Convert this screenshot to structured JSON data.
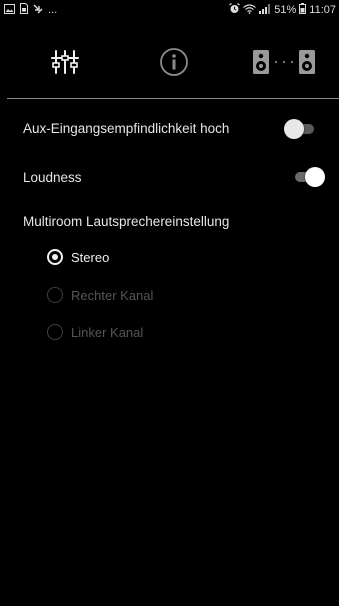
{
  "status_bar": {
    "left_icons": [
      "gallery-icon",
      "sim-icon",
      "missed-call-icon"
    ],
    "ellipsis": "...",
    "battery": "51%",
    "time": "11:07"
  },
  "toolbar": {
    "tabs": [
      {
        "name": "equalizer-settings-tab",
        "icon": "sliders-icon"
      },
      {
        "name": "info-tab",
        "icon": "info-icon"
      },
      {
        "name": "speaker-pairing-tab",
        "icon": "speakers-icon"
      }
    ]
  },
  "settings": {
    "aux_label": "Aux-Eingangsempfindlichkeit hoch",
    "aux_on": false,
    "loudness_label": "Loudness",
    "loudness_on": true,
    "multiroom_title": "Multiroom Lautsprechereinstellung",
    "options": [
      {
        "label": "Stereo",
        "selected": true,
        "enabled": true
      },
      {
        "label": "Rechter Kanal",
        "selected": false,
        "enabled": false
      },
      {
        "label": "Linker Kanal",
        "selected": false,
        "enabled": false
      }
    ]
  },
  "colors": {
    "background": "#000000",
    "text": "#e6e6e6",
    "disabled_text": "#555555"
  }
}
